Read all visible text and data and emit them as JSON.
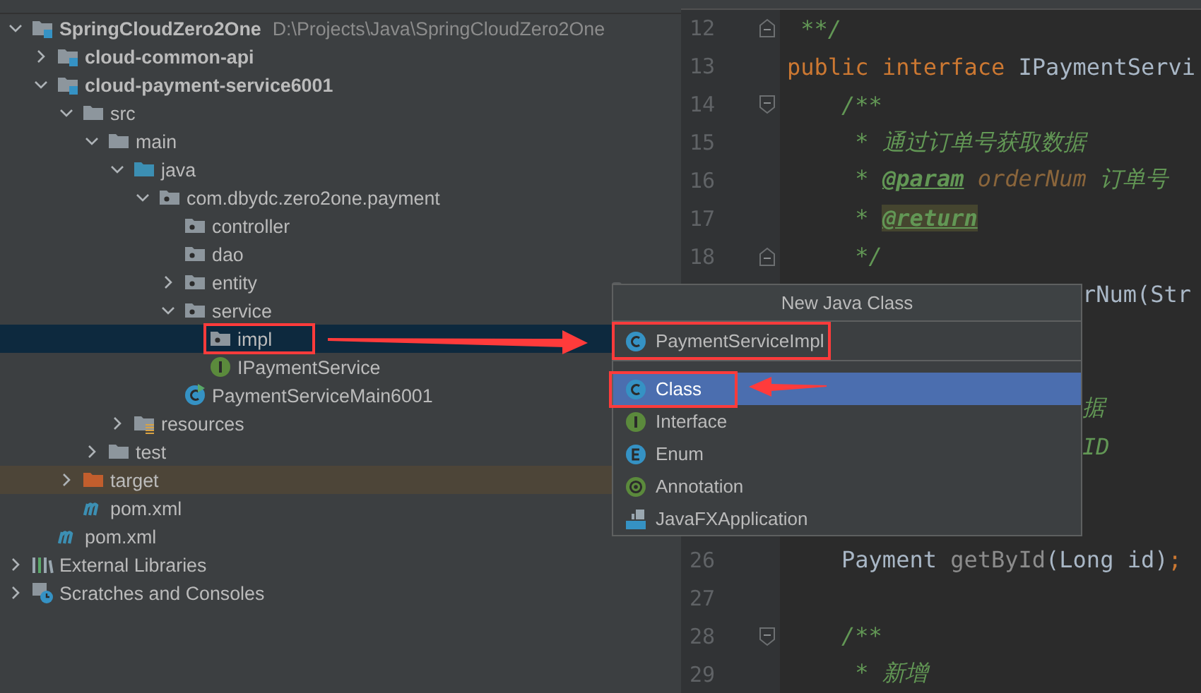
{
  "project_tree": {
    "items": [
      {
        "label": "SpringCloudZero2One",
        "path": "D:\\Projects\\Java\\SpringCloudZero2One",
        "kind": "module",
        "expanded": true,
        "selected": false,
        "children": [
          {
            "label": "cloud-common-api",
            "kind": "module",
            "expanded": false,
            "selected": false
          },
          {
            "label": "cloud-payment-service6001",
            "kind": "module",
            "expanded": true,
            "selected": false,
            "children": [
              {
                "label": "src",
                "kind": "folder",
                "expanded": true,
                "selected": false,
                "children": [
                  {
                    "label": "main",
                    "kind": "folder",
                    "expanded": true,
                    "selected": false,
                    "children": [
                      {
                        "label": "java",
                        "kind": "source-root",
                        "expanded": true,
                        "selected": false,
                        "children": [
                          {
                            "label": "com.dbydc.zero2one.payment",
                            "kind": "package",
                            "expanded": true,
                            "selected": false,
                            "children": [
                              {
                                "label": "controller",
                                "kind": "package",
                                "selected": false
                              },
                              {
                                "label": "dao",
                                "kind": "package",
                                "selected": false
                              },
                              {
                                "label": "entity",
                                "kind": "package",
                                "expanded": false,
                                "selected": false
                              },
                              {
                                "label": "service",
                                "kind": "package",
                                "expanded": true,
                                "selected": false,
                                "children": [
                                  {
                                    "label": "impl",
                                    "kind": "package",
                                    "selected": true
                                  },
                                  {
                                    "label": "IPaymentService",
                                    "kind": "interface",
                                    "selected": false
                                  }
                                ]
                              },
                              {
                                "label": "PaymentServiceMain6001",
                                "kind": "main-class",
                                "selected": false
                              }
                            ]
                          }
                        ]
                      },
                      {
                        "label": "resources",
                        "kind": "resources-root",
                        "expanded": false,
                        "selected": false
                      }
                    ]
                  },
                  {
                    "label": "test",
                    "kind": "folder",
                    "expanded": false,
                    "selected": false
                  }
                ]
              },
              {
                "label": "target",
                "kind": "excluded",
                "expanded": false,
                "selected": false
              },
              {
                "label": "pom.xml",
                "kind": "maven",
                "selected": false
              }
            ]
          },
          {
            "label": "pom.xml",
            "kind": "maven",
            "selected": false
          }
        ]
      },
      {
        "label": "External Libraries",
        "kind": "libraries",
        "expanded": false,
        "selected": false
      },
      {
        "label": "Scratches and Consoles",
        "kind": "scratches",
        "expanded": false,
        "selected": false
      }
    ]
  },
  "editor": {
    "lines": [
      {
        "kind": "code",
        "number": "12",
        "fold_end": true,
        "segments": [
          {
            "text": " **/",
            "kind": "comment"
          }
        ]
      },
      {
        "kind": "code",
        "number": "13",
        "segments": [
          {
            "text": "public interface ",
            "kind": "keyword"
          },
          {
            "text": "IPaymentServi",
            "kind": "plain"
          }
        ]
      },
      {
        "kind": "code",
        "number": "14",
        "fold_start": true,
        "segments": [
          {
            "text": "    /**",
            "kind": "comment"
          }
        ]
      },
      {
        "kind": "code",
        "number": "15",
        "segments": [
          {
            "text": "     * 通过订单号获取数据",
            "kind": "comment"
          }
        ]
      },
      {
        "kind": "code",
        "number": "16",
        "segments": [
          {
            "text": "     * ",
            "kind": "comment"
          },
          {
            "text": "@param",
            "kind": "tag"
          },
          {
            "text": " orderNum",
            "kind": "param"
          },
          {
            "text": " 订单号",
            "kind": "comment"
          }
        ]
      },
      {
        "kind": "code",
        "number": "17",
        "segments": [
          {
            "text": "     * ",
            "kind": "comment"
          },
          {
            "text": "@return",
            "kind": "tag-highlight"
          }
        ]
      },
      {
        "kind": "code",
        "number": "18",
        "fold_end": true,
        "segments": [
          {
            "text": "     */",
            "kind": "comment"
          }
        ]
      },
      {
        "kind": "covered",
        "segments": [
          {
            "text": "rNum(Str",
            "kind": "plain"
          }
        ]
      },
      {
        "kind": "covered"
      },
      {
        "kind": "covered"
      },
      {
        "kind": "covered",
        "segments": [
          {
            "text": "据",
            "kind": "comment"
          }
        ]
      },
      {
        "kind": "covered",
        "segments": [
          {
            "text": "ID",
            "kind": "comment"
          }
        ]
      },
      {
        "kind": "covered"
      },
      {
        "kind": "covered"
      },
      {
        "kind": "code",
        "number": "26",
        "segments": [
          {
            "text": "    Payment ",
            "kind": "plain"
          },
          {
            "text": "getById",
            "kind": "unused"
          },
          {
            "text": "(Long id)",
            "kind": "plain"
          },
          {
            "text": ";",
            "kind": "keyword"
          }
        ]
      },
      {
        "kind": "code",
        "number": "27"
      },
      {
        "kind": "code",
        "number": "28",
        "fold_start": true,
        "segments": [
          {
            "text": "    /**",
            "kind": "comment"
          }
        ]
      },
      {
        "kind": "code",
        "number": "29",
        "segments": [
          {
            "text": "     * 新增",
            "kind": "comment"
          }
        ]
      }
    ]
  },
  "popup": {
    "title": "New Java Class",
    "name_field": {
      "value": "PaymentServiceImpl"
    },
    "items": [
      {
        "label": "Class",
        "kind": "class",
        "selected": true
      },
      {
        "label": "Interface",
        "kind": "interface",
        "selected": false
      },
      {
        "label": "Enum",
        "kind": "enum",
        "selected": false
      },
      {
        "label": "Annotation",
        "kind": "annotation",
        "selected": false
      },
      {
        "label": "JavaFXApplication",
        "kind": "javafx",
        "selected": false
      }
    ]
  }
}
